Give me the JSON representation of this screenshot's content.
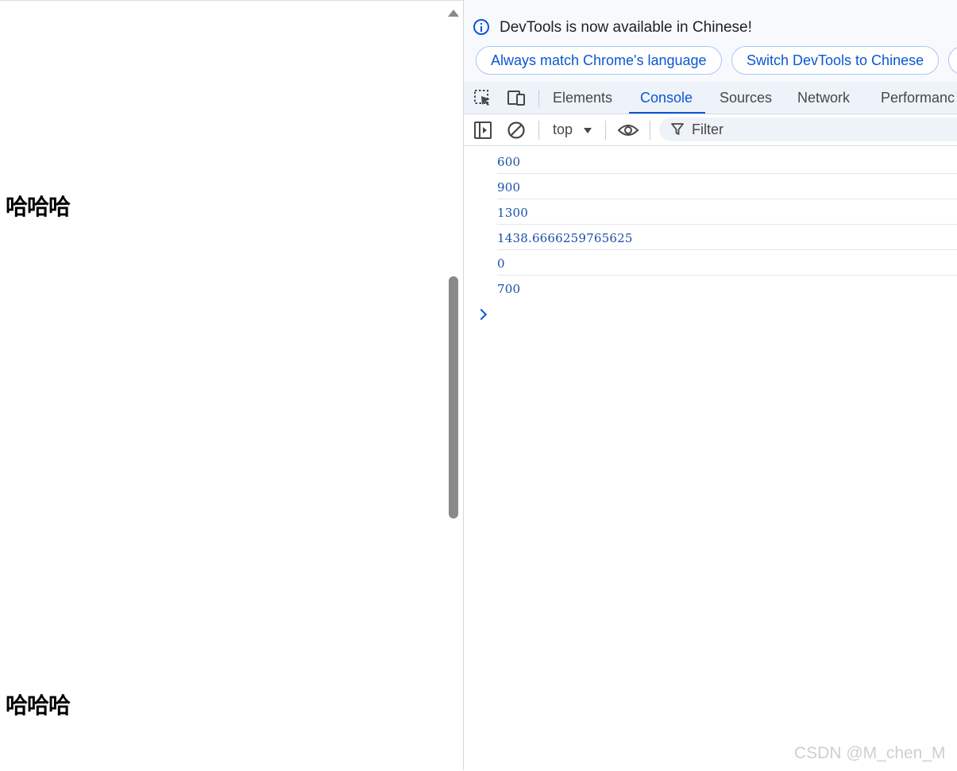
{
  "page": {
    "headings": [
      "哈哈哈",
      "哈哈哈"
    ]
  },
  "infobar": {
    "message": "DevTools is now available in Chinese!",
    "buttons": [
      "Always match Chrome's language",
      "Switch DevTools to Chinese",
      ""
    ]
  },
  "tabs": [
    "Elements",
    "Console",
    "Sources",
    "Network",
    "Performanc"
  ],
  "active_tab": "Console",
  "console_toolbar": {
    "context": "top",
    "filter_placeholder": "Filter"
  },
  "console_logs": [
    "600",
    "900",
    "1300",
    "1438.6666259765625",
    "0",
    "700"
  ],
  "watermark": "CSDN @M_chen_M",
  "colors": {
    "accent": "#0b57d0",
    "log_text": "#1a4fa8",
    "infobar_bg": "#f7f9fc",
    "tabbar_bg": "#eef3fa"
  },
  "icons": [
    "inspect-element-icon",
    "device-toolbar-icon",
    "sidebar-toggle-icon",
    "clear-console-icon",
    "live-expression-eye-icon",
    "filter-funnel-icon",
    "console-prompt-chevron-icon",
    "info-icon"
  ]
}
